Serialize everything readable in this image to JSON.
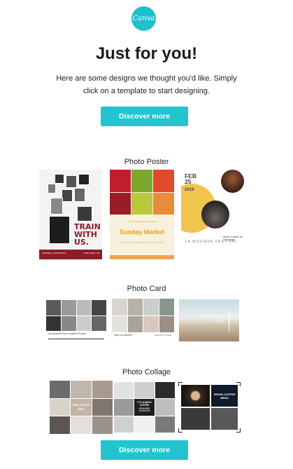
{
  "brand": {
    "logo_text": "Canva",
    "accent": "#22c4d0"
  },
  "header": {
    "title": "Just for you!",
    "subtitle": "Here are some designs we thought you'd like. Simply click on a template to start designing."
  },
  "cta": {
    "top_label": "Discover more",
    "bottom_label": "Discover more"
  },
  "sections": {
    "poster": {
      "title": "Photo Poster",
      "p1_headline": "TRAIN WITH US.",
      "p1_footer_left": "CORNELL GYM EVENTS",
      "p1_footer_right": "PORTLAND, OR",
      "p2_tag": "SOCIAL FARMING PRESENTS",
      "p2_headline": "Sunday Market",
      "p2_info": "CHECK OUT OUR MARKET EVERY SUNDAY",
      "p3_month": "FEB",
      "p3_day": "25",
      "p3_year": "2019",
      "p3_event": "LA MUSIQUE FESTIVAL",
      "p3_info": "ENJOY A NIGHT OF LIVE MUSIC"
    },
    "card": {
      "title": "Photo Card",
      "c1_text": "our adventure from Canada to Europe",
      "c2_text": "Have you Missed?",
      "c2_date": "AUGUST 14 2018",
      "c3_text": "THINKING OF YOU"
    },
    "collage": {
      "title": "Photo Collage",
      "c1_word": "stay in your lane",
      "c2_quote": "IT'S ALWAYS COFFEE O'CLOCK",
      "c2_sub": "COFFEE BAR",
      "c3_title": "FRESH COFFEE MENU"
    }
  }
}
